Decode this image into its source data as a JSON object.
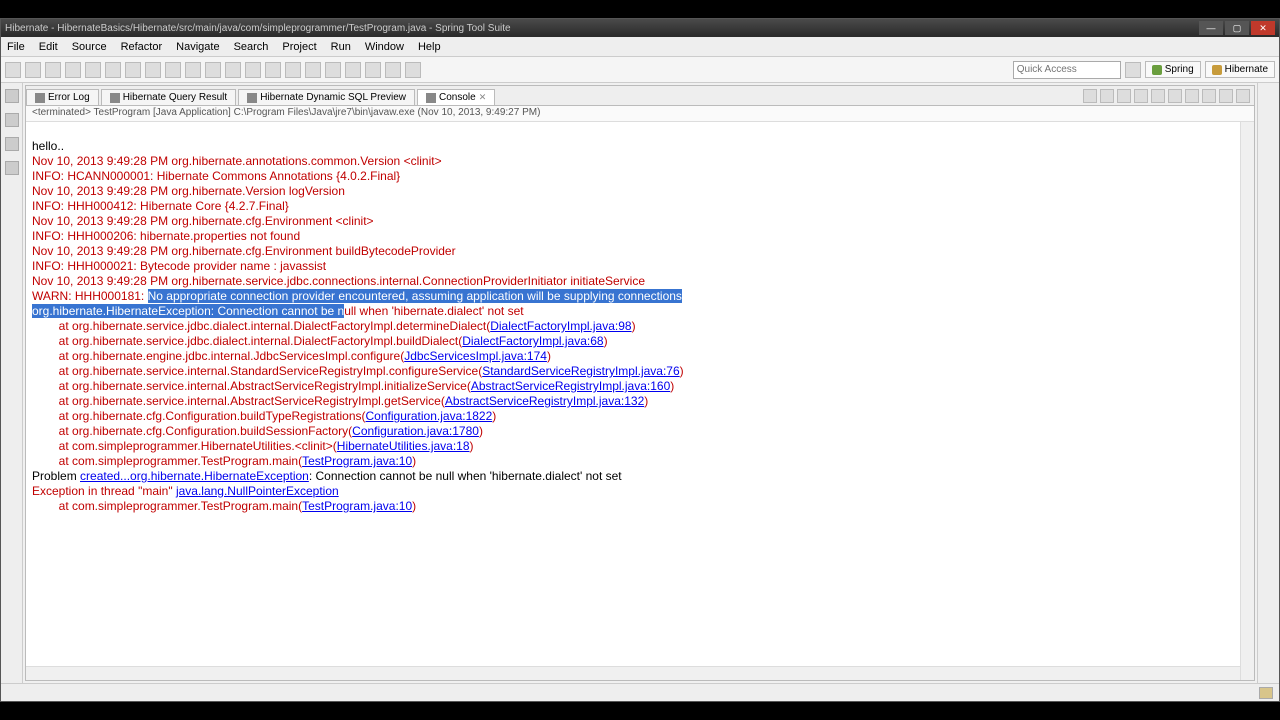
{
  "title": "Hibernate - HibernateBasics/Hibernate/src/main/java/com/simpleprogrammer/TestProgram.java - Spring Tool Suite",
  "menu": [
    "File",
    "Edit",
    "Source",
    "Refactor",
    "Navigate",
    "Search",
    "Project",
    "Run",
    "Window",
    "Help"
  ],
  "quick_access": "Quick Access",
  "perspectives": {
    "spring": "Spring",
    "hibernate": "Hibernate"
  },
  "tabs": {
    "error_log": "Error Log",
    "hql": "Hibernate Query Result",
    "dyn": "Hibernate Dynamic SQL Preview",
    "console": "Console"
  },
  "launch": "<terminated> TestProgram [Java Application] C:\\Program Files\\Java\\jre7\\bin\\javaw.exe (Nov 10, 2013, 9:49:27 PM)",
  "console": {
    "l1": "hello..",
    "l2": "Nov 10, 2013 9:49:28 PM org.hibernate.annotations.common.Version <clinit>",
    "l3": "INFO: HCANN000001: Hibernate Commons Annotations {4.0.2.Final}",
    "l4": "Nov 10, 2013 9:49:28 PM org.hibernate.Version logVersion",
    "l5": "INFO: HHH000412: Hibernate Core {4.2.7.Final}",
    "l6": "Nov 10, 2013 9:49:28 PM org.hibernate.cfg.Environment <clinit>",
    "l7": "INFO: HHH000206: hibernate.properties not found",
    "l8": "Nov 10, 2013 9:49:28 PM org.hibernate.cfg.Environment buildBytecodeProvider",
    "l9": "INFO: HHH000021: Bytecode provider name : javassist",
    "l10": "Nov 10, 2013 9:49:28 PM org.hibernate.service.jdbc.connections.internal.ConnectionProviderInitiator initiateService",
    "l11a": "WARN: HHH000181: ",
    "l11b": "No appropriate connection provider encountered, assuming application will be supplying connections",
    "l12a": "org.hibernate.HibernateException: Connection cannot be n",
    "l12b": "ull when 'hibernate.dialect' not set",
    "l13a": "        at org.hibernate.service.jdbc.dialect.internal.DialectFactoryImpl.determineDialect(",
    "l13l": "DialectFactoryImpl.java:98",
    "l13b": ")",
    "l14a": "        at org.hibernate.service.jdbc.dialect.internal.DialectFactoryImpl.buildDialect(",
    "l14l": "DialectFactoryImpl.java:68",
    "l14b": ")",
    "l15a": "        at org.hibernate.engine.jdbc.internal.JdbcServicesImpl.configure(",
    "l15l": "JdbcServicesImpl.java:174",
    "l15b": ")",
    "l16a": "        at org.hibernate.service.internal.StandardServiceRegistryImpl.configureService(",
    "l16l": "StandardServiceRegistryImpl.java:76",
    "l16b": ")",
    "l17a": "        at org.hibernate.service.internal.AbstractServiceRegistryImpl.initializeService(",
    "l17l": "AbstractServiceRegistryImpl.java:160",
    "l17b": ")",
    "l18a": "        at org.hibernate.service.internal.AbstractServiceRegistryImpl.getService(",
    "l18l": "AbstractServiceRegistryImpl.java:132",
    "l18b": ")",
    "l19a": "        at org.hibernate.cfg.Configuration.buildTypeRegistrations(",
    "l19l": "Configuration.java:1822",
    "l19b": ")",
    "l20a": "        at org.hibernate.cfg.Configuration.buildSessionFactory(",
    "l20l": "Configuration.java:1780",
    "l20b": ")",
    "l21a": "        at com.simpleprogrammer.HibernateUtilities.<clinit>(",
    "l21l": "HibernateUtilities.java:18",
    "l21b": ")",
    "l22a": "        at com.simpleprogrammer.TestProgram.main(",
    "l22l": "TestProgram.java:10",
    "l22b": ")",
    "l23a": "Problem ",
    "l23l": "created...org.hibernate.HibernateException",
    "l23b": ": Connection cannot be null when 'hibernate.dialect' not set",
    "l24a": "Exception in thread \"main\" ",
    "l24l": "java.lang.NullPointerException",
    "l25a": "        at com.simpleprogrammer.TestProgram.main(",
    "l25l": "TestProgram.java:10",
    "l25b": ")"
  }
}
